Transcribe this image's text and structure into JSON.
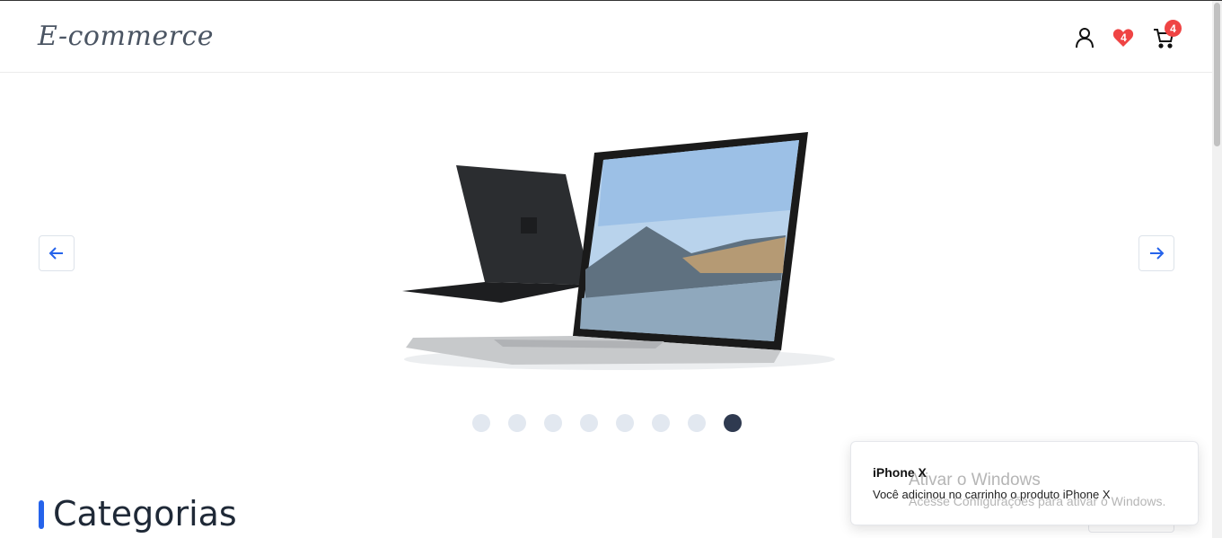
{
  "header": {
    "logo": "E-commerce",
    "wishlist_count": "4",
    "cart_count": "4"
  },
  "carousel": {
    "slide_count": 8,
    "active_index": 7,
    "prev_icon": "arrow-left-icon",
    "next_icon": "arrow-right-icon"
  },
  "section": {
    "title": "Categorias"
  },
  "toast": {
    "title": "iPhone X",
    "message": "Você adicinou no carrinho o produto iPhone X"
  },
  "watermark": {
    "line1": "Ativar o Windows",
    "line2": "Acesse Configurações para ativar o Windows."
  },
  "colors": {
    "accent": "#2563eb",
    "badge": "#ef4444",
    "active_dot": "#2f3a50"
  }
}
